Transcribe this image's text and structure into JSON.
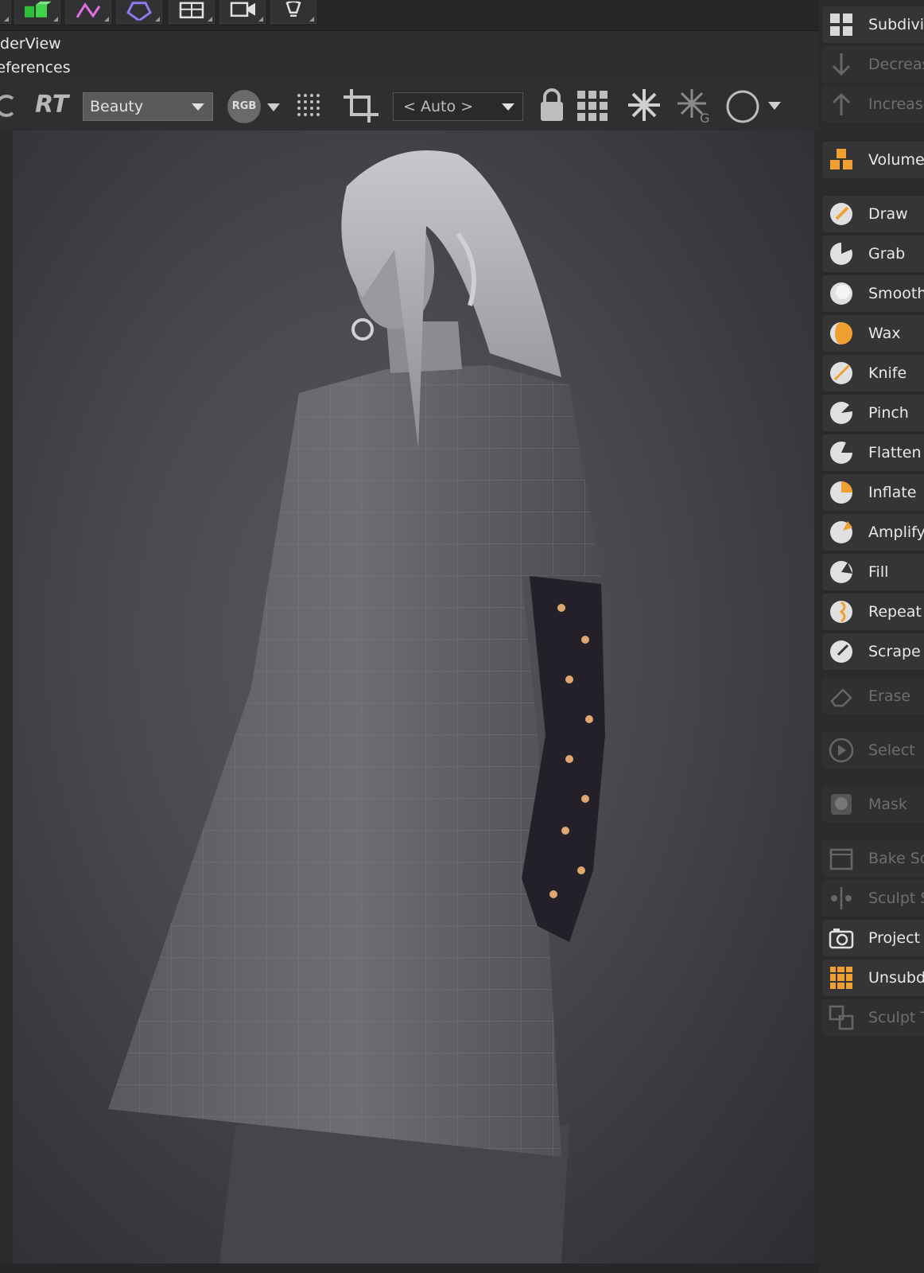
{
  "menus": {
    "line1": "nderView",
    "line2": "references"
  },
  "toolbar": {
    "rt_label": "RT",
    "pass_select": "Beauty",
    "rgb_label": "RGB",
    "auto_select": "< Auto >"
  },
  "sidebar": {
    "items": [
      {
        "label": "Subdivic",
        "icon": "grid-icon",
        "state": "active"
      },
      {
        "label": "Decreas",
        "icon": "arrow-down-icon",
        "state": "disabled"
      },
      {
        "label": "Increase",
        "icon": "arrow-up-icon",
        "state": "disabled"
      },
      {
        "label": "Volume",
        "icon": "volume-cubes-icon",
        "state": "active"
      },
      {
        "label": "Draw",
        "icon": "draw-brush-icon",
        "state": "active"
      },
      {
        "label": "Grab",
        "icon": "grab-brush-icon",
        "state": "active"
      },
      {
        "label": "Smooth",
        "icon": "smooth-brush-icon",
        "state": "active"
      },
      {
        "label": "Wax",
        "icon": "wax-brush-icon",
        "state": "active"
      },
      {
        "label": "Knife",
        "icon": "knife-brush-icon",
        "state": "active"
      },
      {
        "label": "Pinch",
        "icon": "pinch-brush-icon",
        "state": "active"
      },
      {
        "label": "Flatten",
        "icon": "flatten-brush-icon",
        "state": "active"
      },
      {
        "label": "Inflate",
        "icon": "inflate-brush-icon",
        "state": "active"
      },
      {
        "label": "Amplify",
        "icon": "amplify-brush-icon",
        "state": "active"
      },
      {
        "label": "Fill",
        "icon": "fill-brush-icon",
        "state": "active"
      },
      {
        "label": "Repeat",
        "icon": "repeat-brush-icon",
        "state": "active"
      },
      {
        "label": "Scrape",
        "icon": "scrape-brush-icon",
        "state": "active"
      },
      {
        "label": "Erase",
        "icon": "eraser-icon",
        "state": "disabled"
      },
      {
        "label": "Select",
        "icon": "select-icon",
        "state": "disabled"
      },
      {
        "label": "Mask",
        "icon": "mask-icon",
        "state": "disabled"
      },
      {
        "label": "Bake Sc",
        "icon": "bake-icon",
        "state": "disabled"
      },
      {
        "label": "Sculpt S",
        "icon": "symmetry-icon",
        "state": "disabled"
      },
      {
        "label": "Project",
        "icon": "camera-project-icon",
        "state": "active"
      },
      {
        "label": "Unsubd",
        "icon": "unsubdivide-icon",
        "state": "active"
      },
      {
        "label": "Sculpt T",
        "icon": "sculpt-transfer-icon",
        "state": "disabled"
      }
    ]
  },
  "colors": {
    "accent": "#f0a030",
    "background": "#2b2b2d"
  }
}
